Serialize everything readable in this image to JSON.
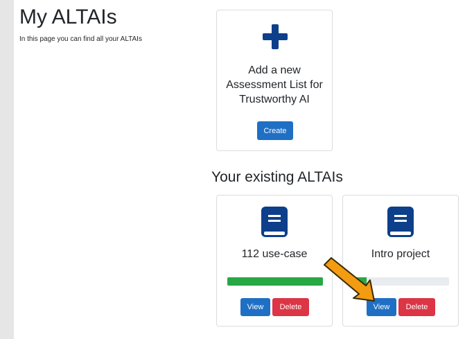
{
  "header": {
    "title": "My ALTAIs",
    "subtitle": "In this page you can find all your ALTAIs"
  },
  "create_card": {
    "icon": "plus-icon",
    "text": "Add a new\nAssessment List for\nTrustworthy AI",
    "button_label": "Create"
  },
  "existing": {
    "title": "Your existing ALTAIs",
    "items": [
      {
        "icon": "book-icon",
        "name": "112 use-case",
        "progress": 1.0,
        "view_label": "View",
        "delete_label": "Delete"
      },
      {
        "icon": "book-icon",
        "name": "Intro project",
        "progress": 0.14,
        "view_label": "View",
        "delete_label": "Delete"
      }
    ]
  },
  "colors": {
    "primary": "#1f6fc5",
    "danger": "#dc3545",
    "success": "#28a745",
    "icon": "#0d3f8a",
    "arrow": "#f39c12"
  }
}
